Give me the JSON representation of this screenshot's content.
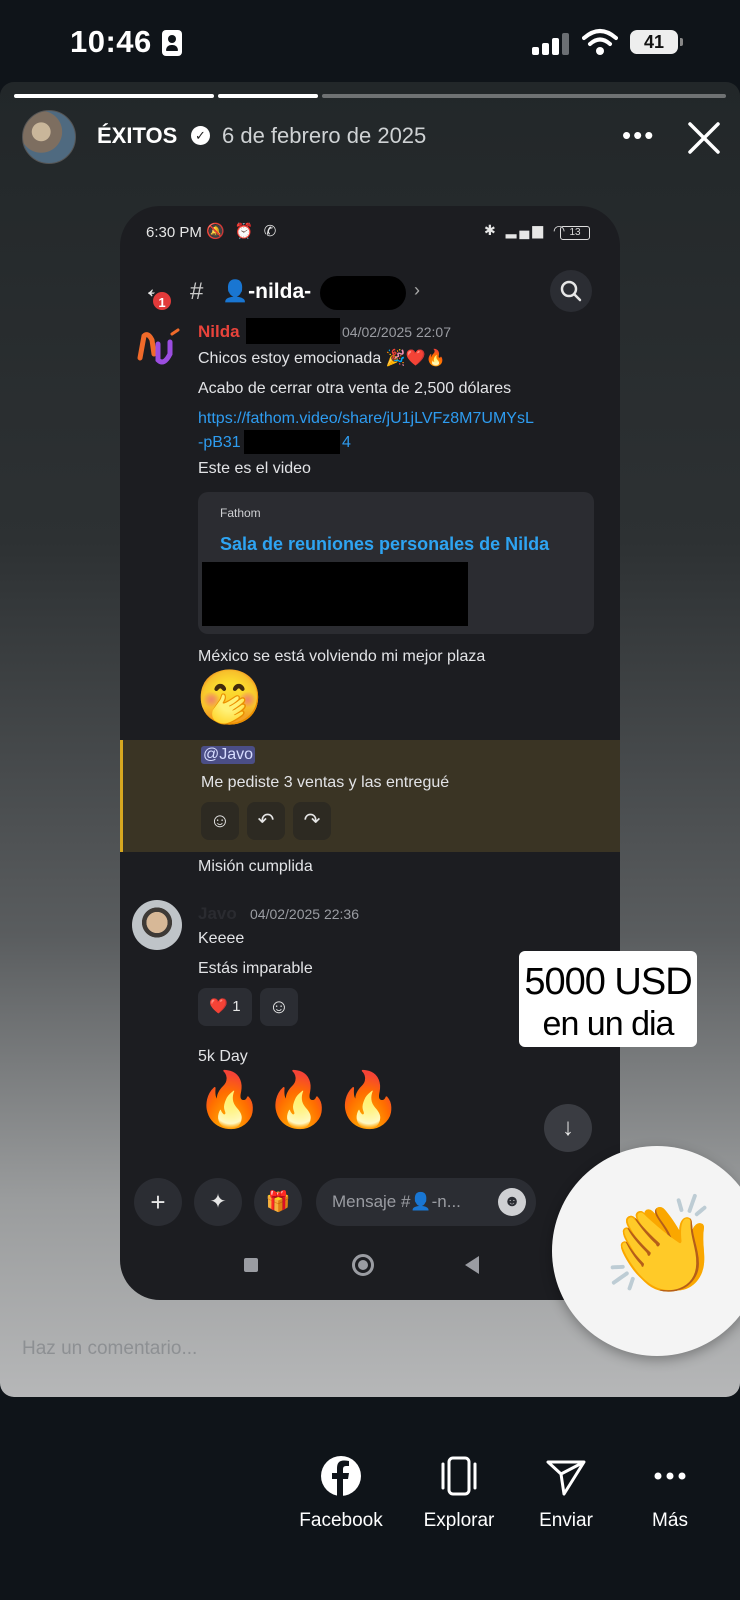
{
  "status_bar": {
    "time": "10:46",
    "battery": "41"
  },
  "story": {
    "account": "ÉXITOS",
    "date": "6 de febrero de 2025",
    "comment_placeholder": "Haz un comentario...",
    "stickers": {
      "line1": "5000 USD",
      "line2": "en un dia",
      "clap": "👏"
    }
  },
  "phone": {
    "time": "6:30 PM",
    "status_icons": "🔕 ⏰ ✆",
    "status_right": "✱ ▂▄▆ ◠",
    "battery": "13",
    "channel": {
      "back_badge": "1",
      "name": "👤-nilda-"
    },
    "messages": {
      "nilda": {
        "user": "Nilda",
        "timestamp": "04/02/2025 22:07",
        "line1": "Chicos estoy emocionada 🎉❤️🔥",
        "line2": "Acabo de cerrar otra venta de 2,500 dólares",
        "link1": "https://fathom.video/share/jU1jLVFz8M7UMYsL",
        "link2_start": "-pB31",
        "link2_end": "4",
        "line3": "Este es el video",
        "embed_provider": "Fathom",
        "embed_title": "Sala de reuniones personales de Nilda",
        "line4": "México se está volviendo mi mejor plaza",
        "emoji1": "🤭",
        "mention": "@Javo",
        "line5": "Me pediste 3 ventas y las entregué",
        "line6": "Misión cumplida"
      },
      "javo": {
        "user": "Javo",
        "timestamp": "04/02/2025 22:36",
        "line1": "Keeee",
        "line2": "Estás imparable",
        "reaction_emoji": "❤️",
        "reaction_count": "1",
        "line3": "5k Day",
        "emoji_row": "🔥🔥🔥"
      }
    },
    "composer_placeholder": "Mensaje #👤-n..."
  },
  "share_bar": {
    "facebook": "Facebook",
    "explorar": "Explorar",
    "enviar": "Enviar",
    "mas": "Más"
  }
}
